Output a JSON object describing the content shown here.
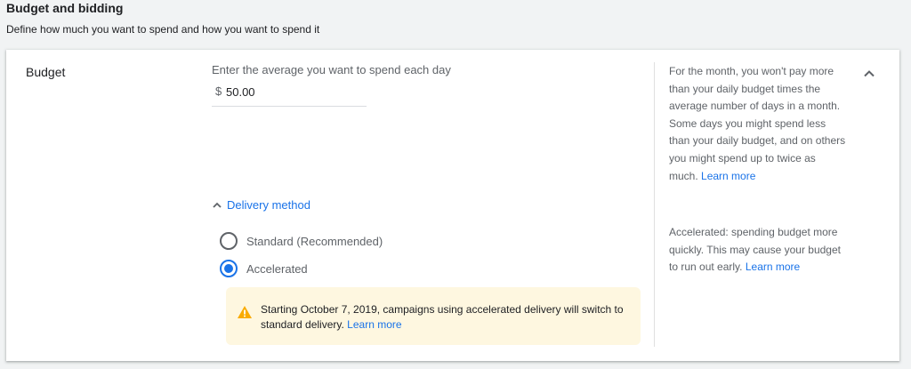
{
  "section": {
    "title": "Budget and bidding",
    "subtitle": "Define how much you want to spend and how you want to spend it"
  },
  "budget": {
    "label": "Budget",
    "hint": "Enter the average you want to spend each day",
    "currency_symbol": "$",
    "value": "50.00",
    "help_text": "For the month, you won't pay more than your daily budget times the average number of days in a month. Some days you might spend less than your daily budget, and on others you might spend up to twice as much.",
    "help_link": "Learn more",
    "collapse_icon": "chevron-up-icon"
  },
  "delivery": {
    "toggle_label": "Delivery method",
    "toggle_icon": "chevron-up-icon",
    "options": [
      {
        "label": "Standard (Recommended)",
        "selected": false
      },
      {
        "label": "Accelerated",
        "selected": true
      }
    ],
    "warning_text": "Starting October 7, 2019, campaigns using accelerated delivery will switch to standard delivery.",
    "warning_link": "Learn more",
    "warning_icon": "warning-icon",
    "help_text": "Accelerated: spending budget more quickly. This may cause your budget to run out early.",
    "help_link": "Learn more"
  },
  "colors": {
    "accent": "#1a73e8",
    "warning_bg": "#fef7e0",
    "warning_icon": "#f9ab00",
    "page_bg": "#f1f3f4"
  }
}
